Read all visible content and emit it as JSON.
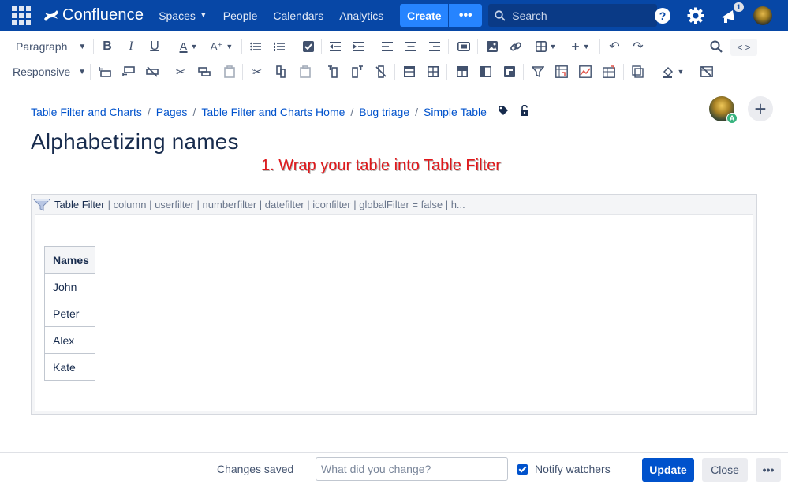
{
  "colors": {
    "nav_bg": "#0747a6",
    "create_bg": "#2684ff",
    "primary": "#0052cc",
    "annotation": "#e0181b"
  },
  "nav": {
    "brand": "Confluence",
    "spaces": "Spaces",
    "people": "People",
    "calendars": "Calendars",
    "analytics": "Analytics",
    "create": "Create",
    "more": "•••",
    "search_placeholder": "Search",
    "notification_count": "1"
  },
  "toolbar": {
    "paragraph_style": "Paragraph",
    "table_layout": "Responsive",
    "source_editor": "< >"
  },
  "breadcrumb": [
    "Table Filter and Charts",
    "Pages",
    "Table Filter and Charts Home",
    "Bug triage",
    "Simple Table"
  ],
  "page": {
    "title": "Alphabetizing names",
    "annotation": "1. Wrap your table into Table Filter",
    "avatar_badge": "A"
  },
  "macro": {
    "name": "Table Filter",
    "params": "| column | userfilter | numberfilter | datefilter | iconfilter | globalFilter = false | h..."
  },
  "table": {
    "header": "Names",
    "rows": [
      "John",
      "Peter",
      "Alex",
      "Kate"
    ]
  },
  "footer": {
    "status": "Changes saved",
    "change_placeholder": "What did you change?",
    "notify_label": "Notify watchers",
    "notify_checked": true,
    "update": "Update",
    "close": "Close",
    "more": "•••"
  }
}
